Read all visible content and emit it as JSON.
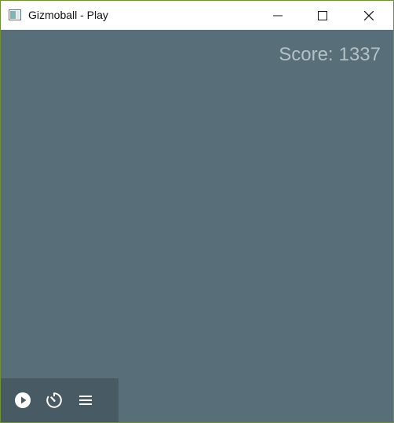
{
  "window": {
    "title": "Gizmoball - Play",
    "title_icon": "window-app-icon",
    "controls": [
      "minimize-icon",
      "maximize-icon",
      "close-icon"
    ]
  },
  "game": {
    "background_color": "#586e78",
    "score_label": "Score:",
    "score_value": "1337",
    "toolbar": {
      "background_color": "#485a63",
      "buttons": [
        "play-icon",
        "tick-timer-icon",
        "menu-icon"
      ]
    }
  }
}
